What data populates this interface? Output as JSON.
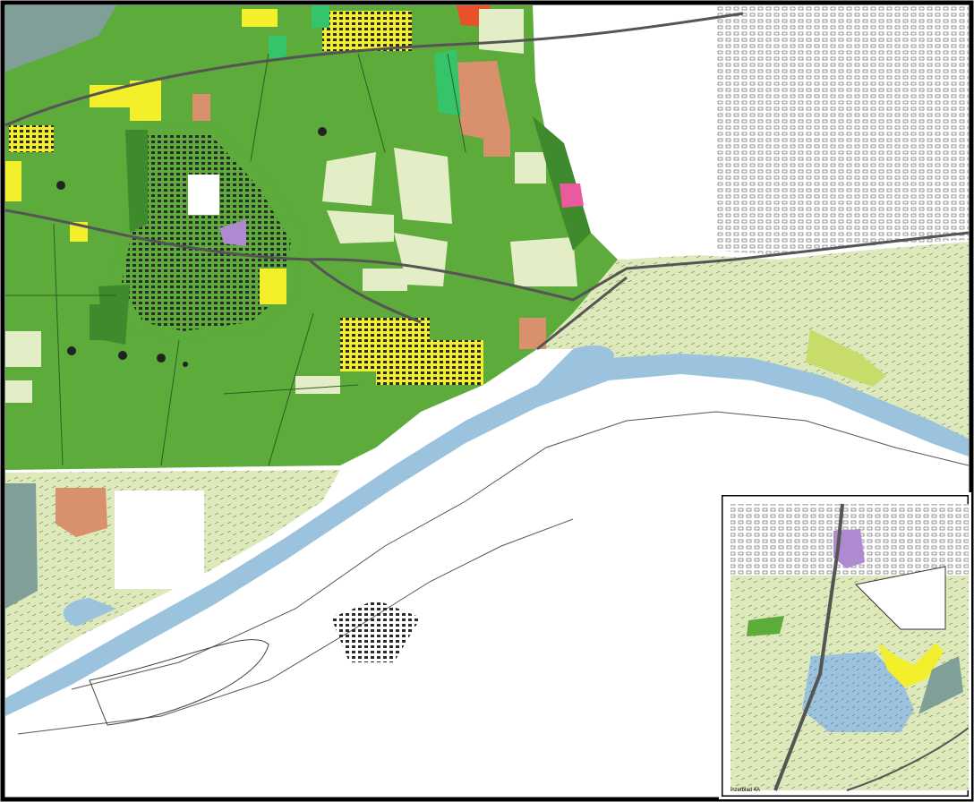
{
  "map": {
    "colors": {
      "agriculture_green": "#5dab3a",
      "forest_dark_green": "#3f8a2c",
      "nature_light_green": "#dde9bb",
      "pale_field": "#e4eec6",
      "river_blue": "#9cc3dd",
      "residential_yellow": "#f3ef2a",
      "commercial_salmon": "#d9906c",
      "civic_purple": "#b08ad0",
      "special_pink": "#ea5a9d",
      "hatch_green": "#c7dc6b",
      "water_grey": "#7f9f98",
      "urban_white": "#ffffff",
      "line_dark": "#1a1a1a",
      "frame": "#000000"
    },
    "inset": {
      "caption": "inzetblad 4A"
    }
  }
}
